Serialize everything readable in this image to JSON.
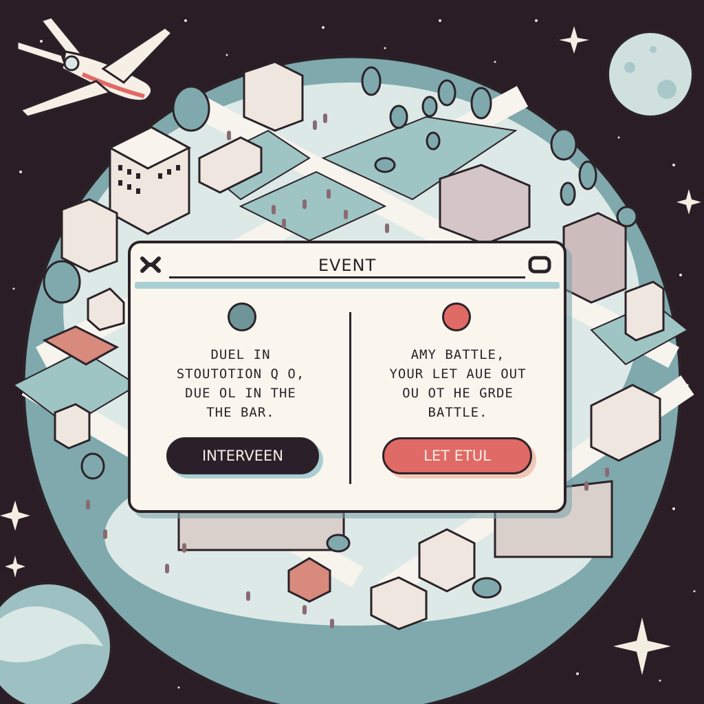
{
  "event": {
    "title": "EVENT",
    "left": {
      "text": "DUEL  IN\nSTOUTOTION  Q O,\nDUE OL  IN THE\nTHE BAR.",
      "button_label": "INTERVEEN"
    },
    "right": {
      "text": "AMY BATTLE,\nYOUR  LET  AUE  OUT\nOU OT  HE GRDE\nBATTLE.",
      "button_label": "LET ETUL"
    }
  },
  "colors": {
    "space": "#2a1d26",
    "planet": "#7fa9ad",
    "ground": "#dde9e6",
    "accent_red": "#e06a66",
    "dark": "#2b1f2a",
    "orb_left": "#6f9598",
    "orb_right": "#e06a66"
  },
  "icons": [
    "airplane-icon",
    "close-icon",
    "window-icon",
    "star-icon",
    "moon-icon"
  ]
}
